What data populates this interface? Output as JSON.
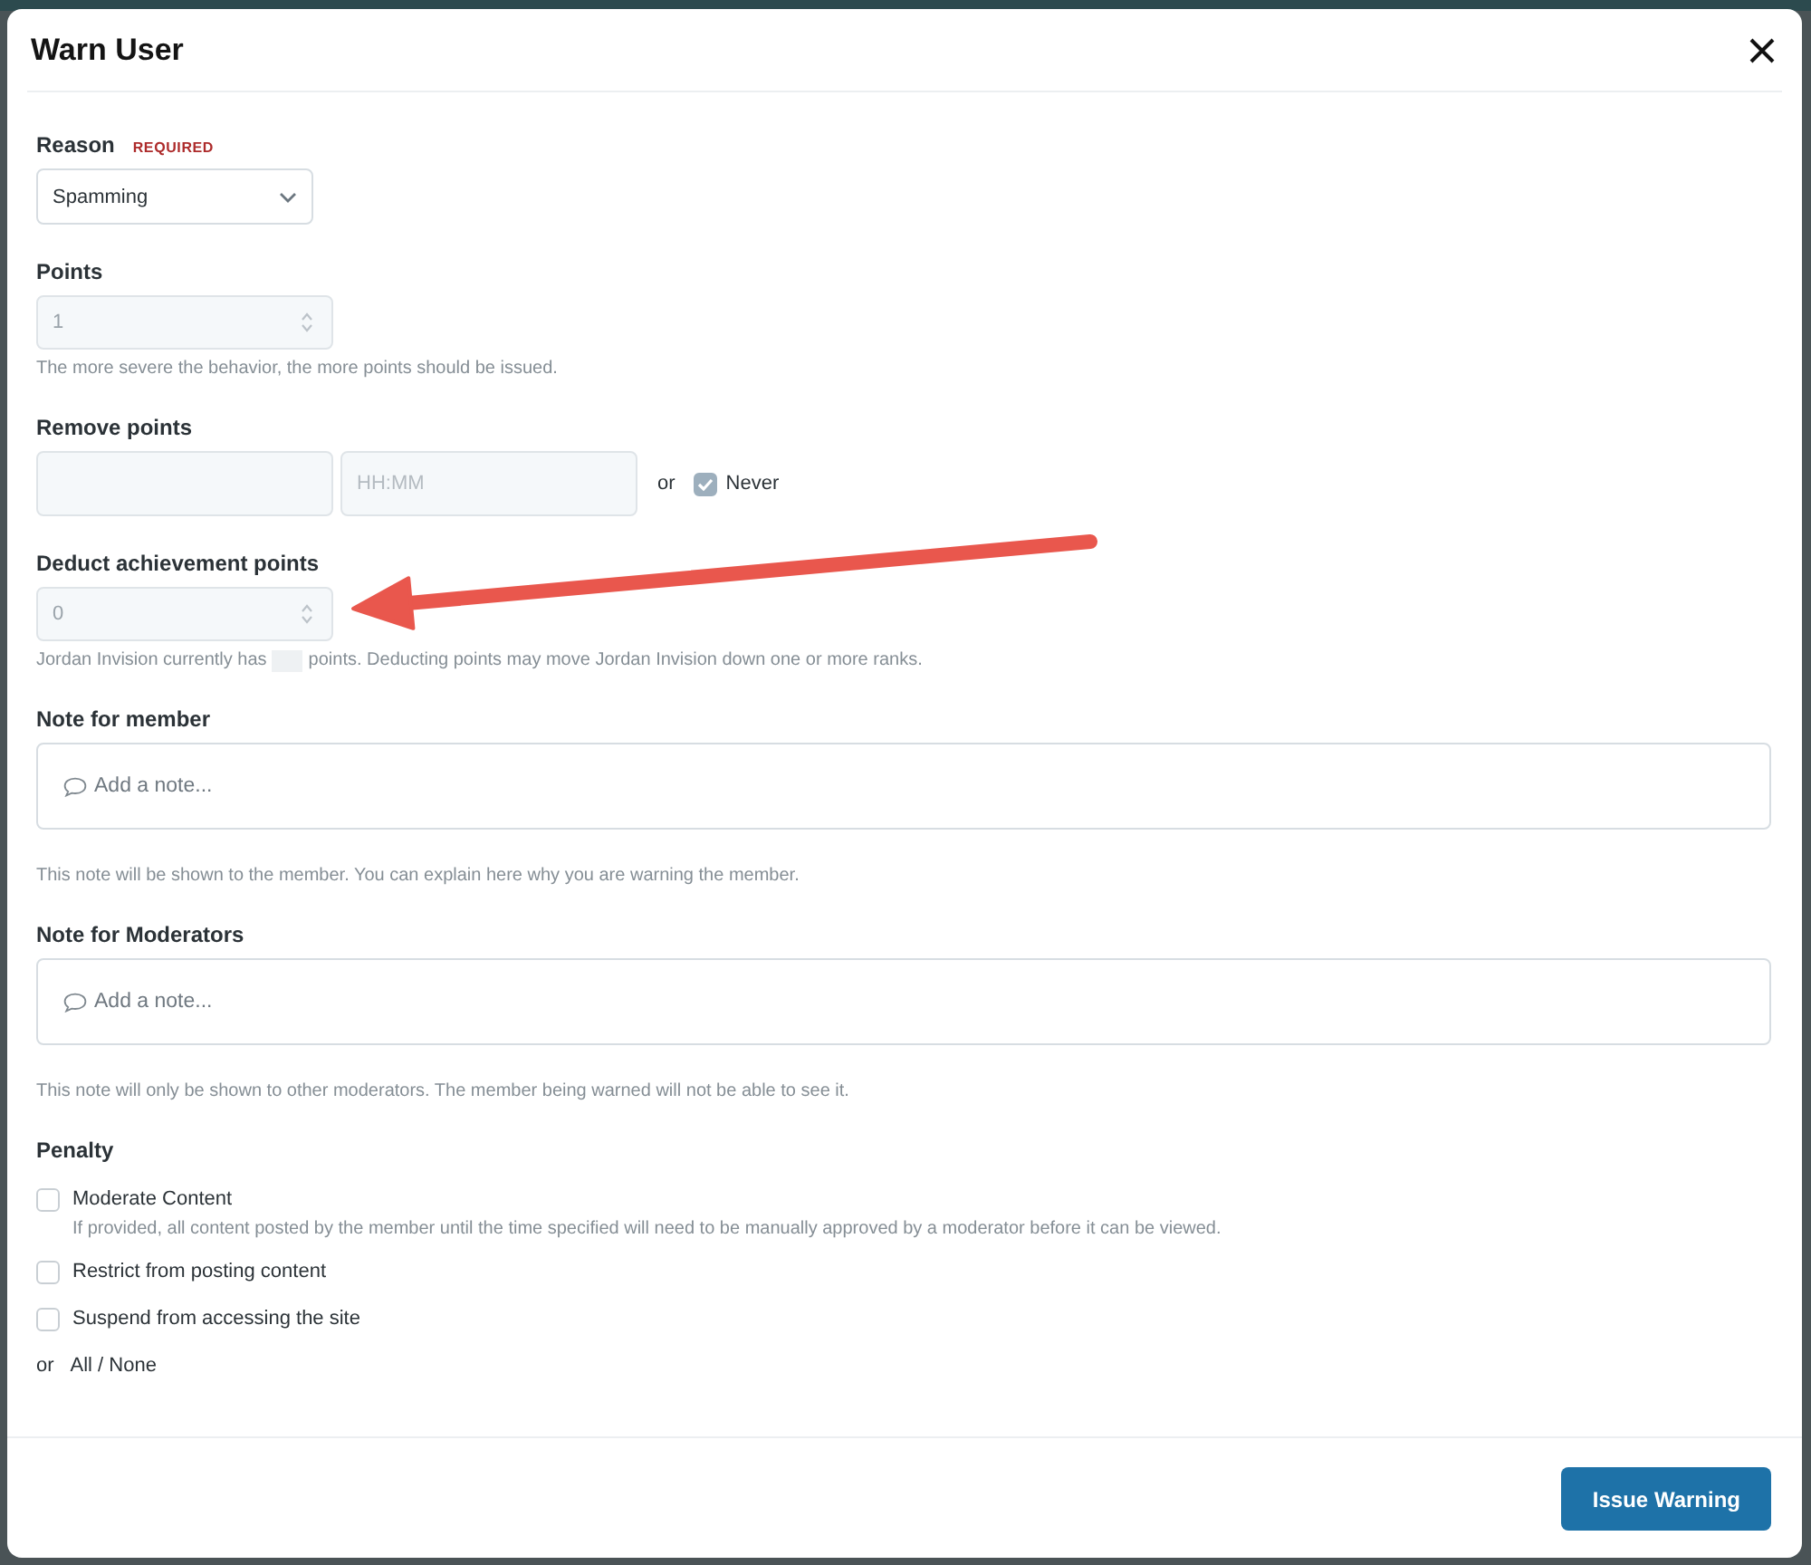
{
  "dialog": {
    "title": "Warn User"
  },
  "fields": [
    {
      "kind": "select",
      "label": "Reason",
      "required_tag": "REQUIRED",
      "value": "Spamming"
    },
    {
      "kind": "number",
      "label": "Points",
      "value": "1",
      "disabled": true,
      "hint": "The more severe the behavior, the more points should be issued."
    },
    {
      "kind": "datetime",
      "label": "Remove points",
      "disabled": true,
      "time_placeholder": "HH:MM",
      "or_text": "or",
      "never": {
        "label": "Never",
        "checked": true
      }
    },
    {
      "kind": "number",
      "label": "Deduct achievement points",
      "value": "0",
      "disabled": true,
      "arrow_annotated": true,
      "hint_parts": [
        "Jordan Invision currently has",
        "points. Deducting points may move Jordan Invision down one or more ranks."
      ]
    },
    {
      "kind": "textarea",
      "label": "Note for member",
      "placeholder": "Add a note...",
      "hint": "This note will be shown to the member. You can explain here why you are warning the member."
    },
    {
      "kind": "textarea",
      "label": "Note for Moderators",
      "placeholder": "Add a note...",
      "hint": "This note will only be shown to other moderators. The member being warned will not be able to see it."
    },
    {
      "kind": "checkboxes",
      "label": "Penalty",
      "options": [
        {
          "label": "Moderate Content",
          "checked": false,
          "description": "If provided, all content posted by the member until the time specified will need to be manually approved by a moderator before it can be viewed."
        },
        {
          "label": "Restrict from posting content",
          "checked": false
        },
        {
          "label": "Suspend from accessing the site",
          "checked": false
        }
      ],
      "toggle_prefix": "or",
      "toggle_link": "All / None"
    }
  ],
  "footer": {
    "buttons": [
      {
        "label": "Issue Warning",
        "kind": "primary"
      }
    ]
  }
}
